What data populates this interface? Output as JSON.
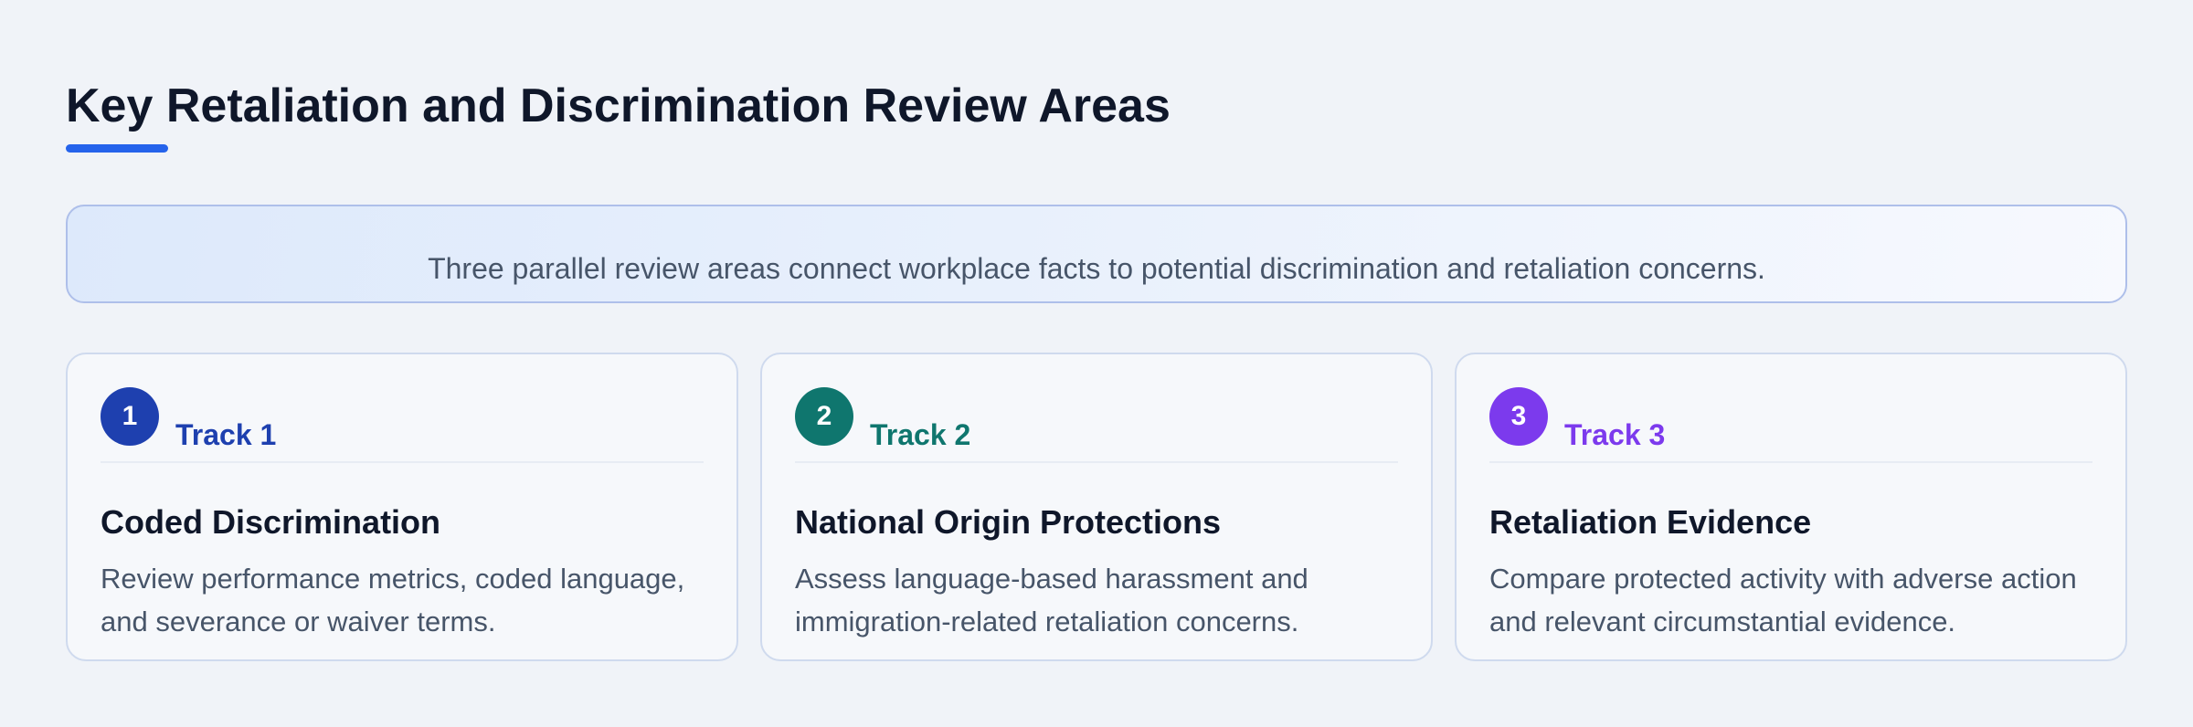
{
  "page": {
    "title": "Key Retaliation and Discrimination Review Areas",
    "accent_color": "#2563eb"
  },
  "banner": {
    "text": "Three parallel review areas connect workplace facts to potential discrimination and retaliation concerns."
  },
  "tracks": [
    {
      "number": "1",
      "label": "Track 1",
      "title": "Coded Discrimination",
      "description": "Review performance metrics, coded language, and severance or waiver terms.",
      "color": "#1e40af"
    },
    {
      "number": "2",
      "label": "Track 2",
      "title": "National Origin Protections",
      "description": "Assess language-based harassment and immigration-related retaliation concerns.",
      "color": "#0f766e"
    },
    {
      "number": "3",
      "label": "Track 3",
      "title": "Retaliation Evidence",
      "description": "Compare protected activity with adverse action and relevant circumstantial evidence.",
      "color": "#7c3aed"
    }
  ]
}
